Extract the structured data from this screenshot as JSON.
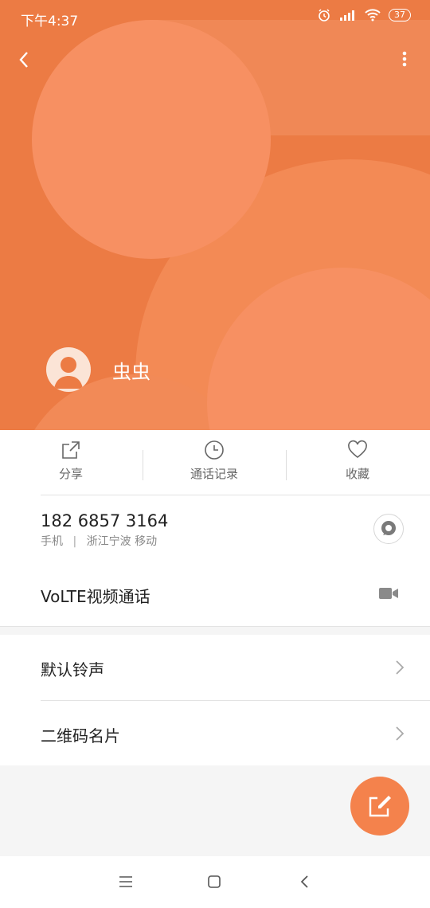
{
  "status_bar": {
    "time": "下午4:37",
    "battery": "37"
  },
  "colors": {
    "accent": "#ec7b44",
    "fab": "#f4824c"
  },
  "contact": {
    "name": "虫虫"
  },
  "actions": [
    {
      "label": "分享",
      "icon": "share-icon"
    },
    {
      "label": "通话记录",
      "icon": "clock-icon"
    },
    {
      "label": "收藏",
      "icon": "heart-icon"
    }
  ],
  "phone": {
    "number": "182 6857 3164",
    "type": "手机",
    "separator": "|",
    "location": "浙江宁波 移动"
  },
  "volte": {
    "label": "VoLTE视频通话"
  },
  "settings": [
    {
      "label": "默认铃声"
    },
    {
      "label": "二维码名片"
    }
  ]
}
